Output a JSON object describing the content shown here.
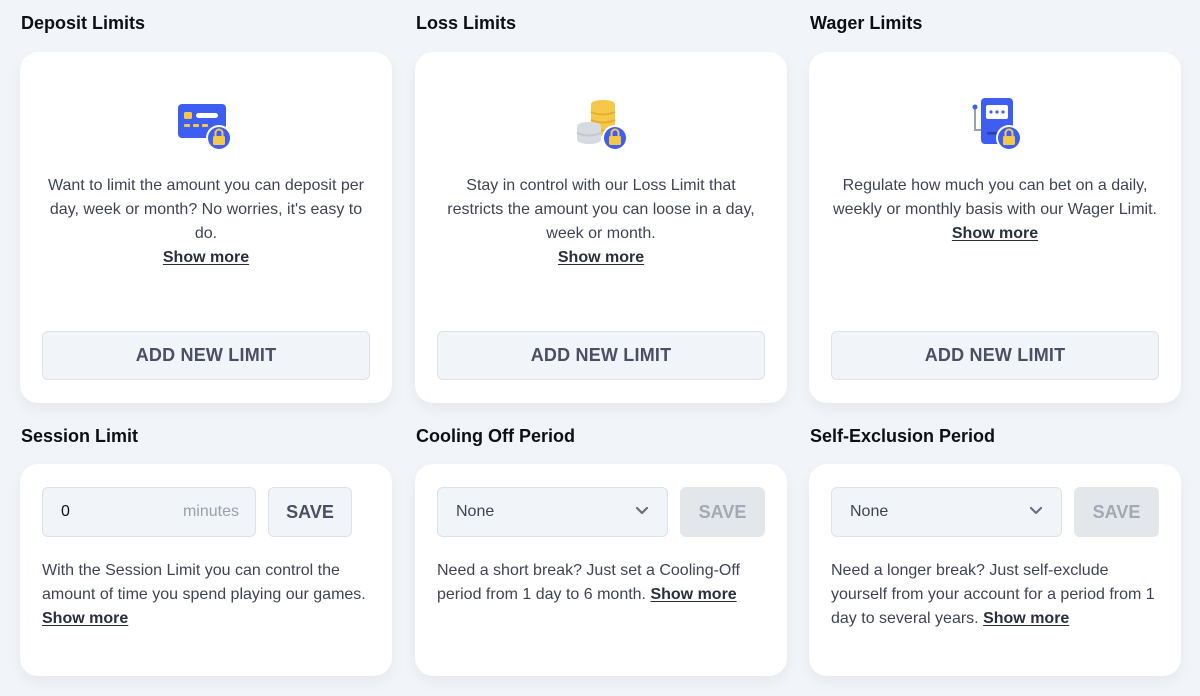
{
  "colors": {
    "background": "#f1f4f8",
    "card": "#ffffff",
    "icon_blue": "#3d5ef0",
    "icon_yellow": "#f6c84a",
    "button_bg": "#f1f4f8",
    "button_text": "#4a4f63",
    "disabled_button_bg": "#e3e6eb",
    "disabled_button_text": "#a3a8b3"
  },
  "deposit_limits": {
    "title": "Deposit Limits",
    "icon": "credit-card-lock-icon",
    "description": "Want to limit the amount you can deposit per day, week or month? No worries, it's easy to do.",
    "show_more": "Show more",
    "button": "ADD NEW LIMIT"
  },
  "loss_limits": {
    "title": "Loss Limits",
    "icon": "coins-lock-icon",
    "description": "Stay in control with our Loss Limit that restricts the amount you can loose in a day, week or month.",
    "show_more": "Show more",
    "button": "ADD NEW LIMIT"
  },
  "wager_limits": {
    "title": "Wager Limits",
    "icon": "slot-machine-lock-icon",
    "description": "Regulate how much you can bet on a daily, weekly or monthly basis with our Wager Limit.",
    "show_more": "Show more",
    "button": "ADD NEW LIMIT"
  },
  "session_limit": {
    "title": "Session Limit",
    "input_value": "0",
    "input_suffix": "minutes",
    "save": "SAVE",
    "description": "With the Session Limit you can control the amount of time you spend playing our games.",
    "show_more": "Show more"
  },
  "cooling_off": {
    "title": "Cooling Off Period",
    "selected": "None",
    "save": "SAVE",
    "save_disabled": true,
    "description": "Need a short break? Just set a Cooling-Off period from 1 day to 6 month.",
    "show_more": "Show more"
  },
  "self_exclusion": {
    "title": "Self-Exclusion Period",
    "selected": "None",
    "save": "SAVE",
    "save_disabled": true,
    "description": "Need a longer break? Just self-exclude yourself from your account for a period from 1 day to several years.",
    "show_more": "Show more"
  }
}
